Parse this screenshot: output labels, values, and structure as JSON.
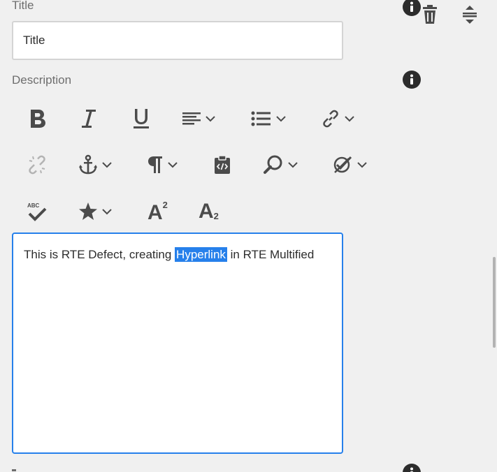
{
  "title_field": {
    "label": "Title",
    "value": "Title"
  },
  "description": {
    "label": "Description",
    "content_before": "This is RTE Defect, creating ",
    "content_selected": "Hyperlink",
    "content_after": " in RTE Multified"
  },
  "header_actions": {
    "info_icon": "info-icon",
    "delete_icon": "trash-icon",
    "reorder_icon": "reorder-icon"
  },
  "toolbar": {
    "row1": [
      "bold-icon",
      "italic-icon",
      "underline-icon",
      "justify-icon",
      "list-icon",
      "link-icon"
    ],
    "row2": [
      "unlink-icon",
      "anchor-icon",
      "paragraph-icon",
      "paste-as-source-icon",
      "find-replace-icon",
      "spellcheck-dropdown-icon"
    ],
    "row3": [
      "spellcheck-icon",
      "special-char-icon",
      "superscript-icon",
      "subscript-icon"
    ],
    "superscript_glyph": "A",
    "superscript_sup": "2",
    "subscript_glyph": "A",
    "subscript_sub": "2",
    "spellcheck_text": "ABC"
  },
  "colors": {
    "background": "#f0f0f0",
    "icon": "#4b4b4b",
    "icon_disabled": "#b3b3b3",
    "accent": "#2680eb",
    "border": "#d4d4d4"
  }
}
